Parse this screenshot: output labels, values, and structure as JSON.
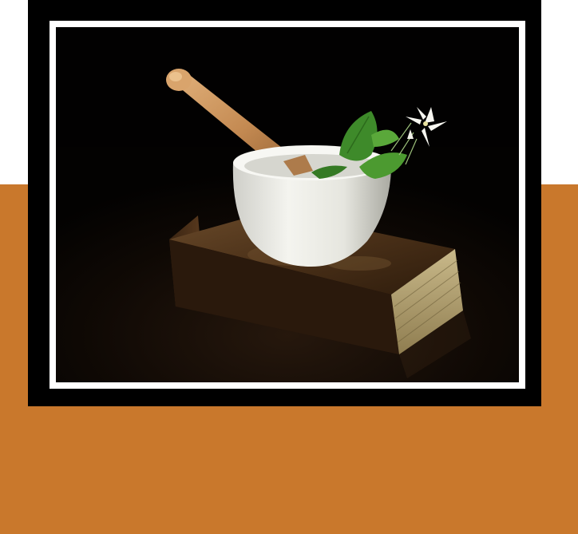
{
  "page": {
    "background_top_color": "#ffffff",
    "background_bottom_color": "#c9782c",
    "frame_color": "#000000",
    "frame_border_color": "#ffffff"
  },
  "photo": {
    "subject_icons": [
      "mortar-icon",
      "pestle-icon",
      "green-leaf-icon",
      "white-flower-icon",
      "old-book-icon"
    ]
  }
}
